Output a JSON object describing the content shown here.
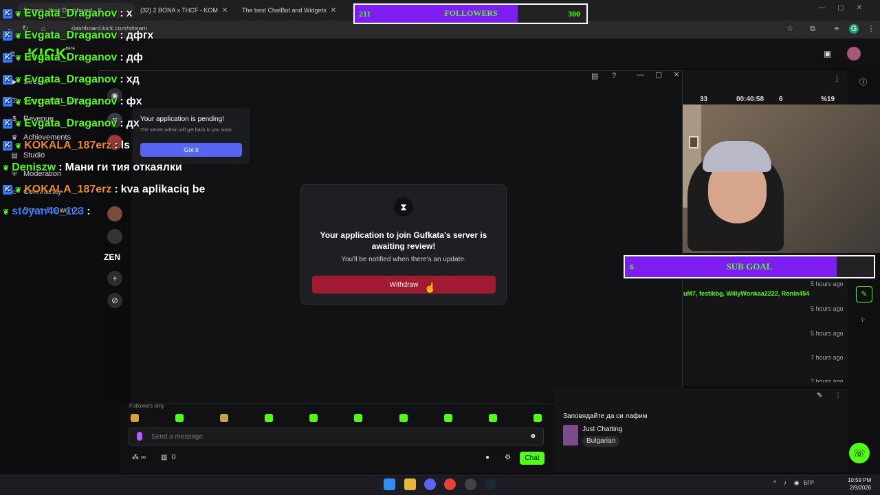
{
  "browser": {
    "tabs": [
      {
        "label": "Stream - Kick Dashboard",
        "active": true
      },
      {
        "label": "(32) 2 BONA x THCF - KOM",
        "active": false
      },
      {
        "label": "The best ChatBot and Widgets",
        "active": false
      }
    ],
    "url": "dashboard.kick.com/stream"
  },
  "kick": {
    "logo": "KICK",
    "logo_badge": "BETA",
    "sidebar": [
      {
        "label": "Stream",
        "icon": "video-icon"
      },
      {
        "label": "Stream URL & Key",
        "icon": "key-icon"
      },
      {
        "label": "Revenue",
        "icon": "dollar-icon"
      },
      {
        "label": "Achievements",
        "icon": "trophy-icon"
      },
      {
        "label": "Studio",
        "icon": "studio-icon"
      },
      {
        "label": "Moderation",
        "icon": "shield-icon"
      },
      {
        "label": "Community",
        "icon": "users-icon"
      },
      {
        "label": "Drops & rewards",
        "icon": "gift-icon"
      }
    ]
  },
  "discord": {
    "popup": {
      "title": "Your application is pending!",
      "subtitle": "The server admin will get back to you soon.",
      "button": "Got it"
    },
    "dialog": {
      "title": "Your application to join Gufkata's server is awaiting review!",
      "subtitle": "You'll be notified when there's an update.",
      "button": "Withdraw"
    },
    "guild_label": "ZEN"
  },
  "overlay": {
    "followers": {
      "current": "211",
      "label": "FOLLOWERS",
      "goal": "300",
      "fraction": 0.703
    },
    "subgoal": {
      "current": "6",
      "label": "SUB GOAL",
      "fraction": 0.85
    },
    "chat": [
      {
        "user": "Evgata_Draganov",
        "msg": "x",
        "color": "#53fc18"
      },
      {
        "user": "Evgata_Draganov",
        "msg": "дфгх",
        "color": "#53fc18"
      },
      {
        "user": "Evgata_Draganov",
        "msg": "дф",
        "color": "#53fc18"
      },
      {
        "user": "Evgata_Draganov",
        "msg": "хд",
        "color": "#53fc18"
      },
      {
        "user": "Evgata_Draganov",
        "msg": "фх",
        "color": "#53fc18"
      },
      {
        "user": "Evgata_Draganov",
        "msg": "дх",
        "color": "#53fc18"
      },
      {
        "user": "KOKALA_187erz",
        "msg": "ls",
        "color": "#f08a24"
      },
      {
        "user": "Deniszw",
        "msg": "Мани ги тия откаялки",
        "color": "#53fc18"
      },
      {
        "user": "KOKALA_187erz",
        "msg": "kva aplikaciq be",
        "color": "#f08a24"
      },
      {
        "user": "stoyan40_123",
        "msg": "",
        "color": "#2f7cff"
      }
    ]
  },
  "stats": {
    "viewers": "33",
    "uptime": "00:40:58",
    "followers_new": "6",
    "percent": "%19"
  },
  "recent": {
    "names": "uM7, festikbg, WillyWonkaa2222, Ronin454",
    "times": [
      "5 hours ago",
      "5 hours ago",
      "5 hours ago",
      "7 hours ago",
      "7 hours ago"
    ]
  },
  "chat_panel": {
    "followers_only": "Followers only",
    "placeholder": "Send a message",
    "points": "∞",
    "gifts": "0",
    "send": "Chat"
  },
  "stream_info": {
    "title": "Заповядайте да си лафим",
    "category": "Just Chatting",
    "tag": "Bulgarian"
  },
  "taskbar": {
    "lang": "БГР",
    "time": "10:59 PM",
    "date": "2/9/2026"
  }
}
